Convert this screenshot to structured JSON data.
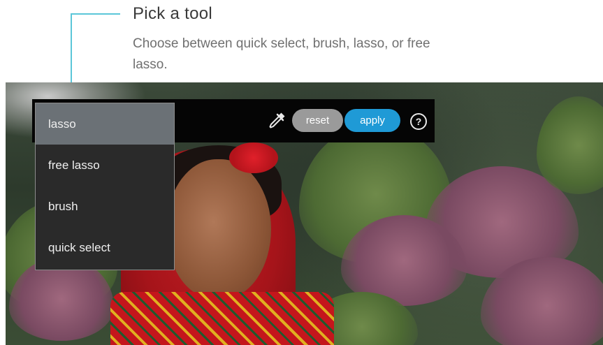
{
  "tooltip": {
    "title": "Pick a tool",
    "description": "Choose between quick select, brush, lasso, or free lasso."
  },
  "toolbar": {
    "tool_menu": {
      "selected": "lasso",
      "options": [
        "lasso",
        "free lasso",
        "brush",
        "quick select"
      ]
    },
    "eyedropper_icon": "eyedropper-icon",
    "reset_label": "reset",
    "apply_label": "apply",
    "help_icon": "help-icon",
    "help_glyph": "?"
  },
  "colors": {
    "accent_line": "#5bc6d9",
    "apply_button": "#1f9ad6",
    "reset_button": "#9a9a9a",
    "toolbar_bg": "#050505",
    "menu_bg": "#2a2a2a",
    "menu_selected_bg": "#6b7176"
  }
}
